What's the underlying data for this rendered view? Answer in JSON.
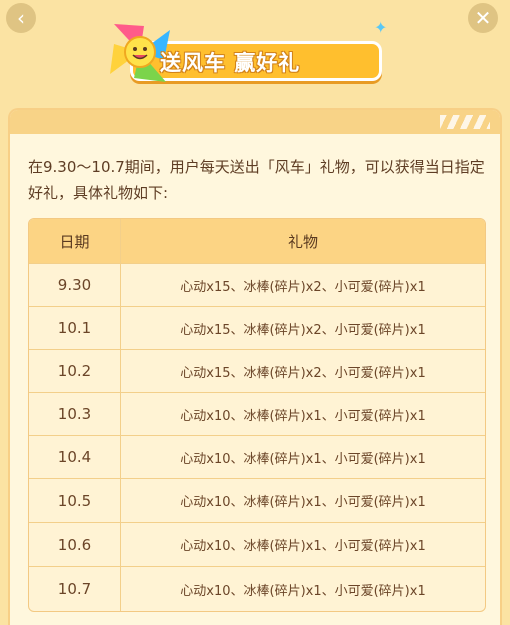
{
  "nav": {
    "back_icon": "‹",
    "close_icon": "✕"
  },
  "banner": {
    "title": "送风车 赢好礼"
  },
  "intro": "在9.30～10.7期间，用户每天送出「风车」礼物，可以获得当日指定好礼，具体礼物如下:",
  "table": {
    "headers": {
      "date": "日期",
      "gift": "礼物"
    },
    "rows": [
      {
        "date": "9.30",
        "gift": "心动x15、冰棒(碎片)x2、小可爱(碎片)x1"
      },
      {
        "date": "10.1",
        "gift": "心动x15、冰棒(碎片)x2、小可爱(碎片)x1"
      },
      {
        "date": "10.2",
        "gift": "心动x15、冰棒(碎片)x2、小可爱(碎片)x1"
      },
      {
        "date": "10.3",
        "gift": "心动x10、冰棒(碎片)x1、小可爱(碎片)x1"
      },
      {
        "date": "10.4",
        "gift": "心动x10、冰棒(碎片)x1、小可爱(碎片)x1"
      },
      {
        "date": "10.5",
        "gift": "心动x10、冰棒(碎片)x1、小可爱(碎片)x1"
      },
      {
        "date": "10.6",
        "gift": "心动x10、冰棒(碎片)x1、小可爱(碎片)x1"
      },
      {
        "date": "10.7",
        "gift": "心动x10、冰棒(碎片)x1、小可爱(碎片)x1"
      }
    ]
  },
  "colors": {
    "background": "#fbe3a3",
    "card": "#fff7dd",
    "header_row": "#fcd484",
    "text": "#6b4528"
  }
}
